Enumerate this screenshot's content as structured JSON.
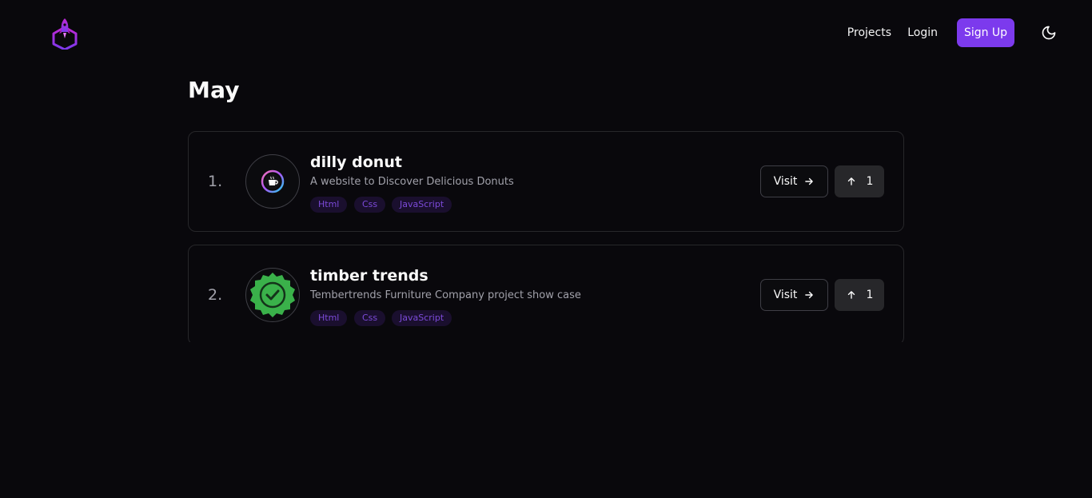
{
  "nav": {
    "projects": "Projects",
    "login": "Login",
    "signup": "Sign Up"
  },
  "month": "May",
  "colors": {
    "accent": "#7c3aed",
    "tag_bg": "#1a0f2e",
    "tag_text": "#7c4ad9",
    "background": "#09080c"
  },
  "projects": [
    {
      "rank": "1.",
      "name": "dilly donut",
      "description": "A website to Discover Delicious Donuts",
      "icon": "coffee-cup-logo-icon",
      "tags": [
        "Html",
        "Css",
        "JavaScript"
      ],
      "visit_label": "Visit",
      "upvotes": "1"
    },
    {
      "rank": "2.",
      "name": "timber trends",
      "description": "Tembertrends Furniture Company project show case",
      "icon": "green-check-badge-icon",
      "tags": [
        "Html",
        "Css",
        "JavaScript"
      ],
      "visit_label": "Visit",
      "upvotes": "1"
    }
  ]
}
